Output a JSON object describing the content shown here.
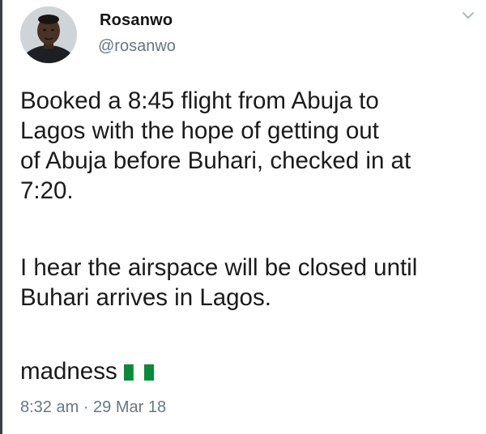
{
  "tweet": {
    "display_name": "Rosanwo",
    "handle": "@rosanwo",
    "paragraph_1": "Booked a 8:45 flight from Abuja to\nLagos with the hope of getting out\nof Abuja before Buhari, checked in at\n7:20.",
    "paragraph_2": "I hear the airspace will be closed until\nBuhari arrives in Lagos.",
    "paragraph_3": "madness",
    "time": "8:32 am",
    "separator": " · ",
    "date": "29 Mar 18"
  },
  "icons": {
    "menu": "chevron-down-icon",
    "flag": "nigeria-flag-icon"
  },
  "colors": {
    "name": "#141414",
    "secondary": "#657786",
    "body": "#1a1a1a",
    "flag_green": "#0b8a3a",
    "left_border": "#3a3f44"
  }
}
